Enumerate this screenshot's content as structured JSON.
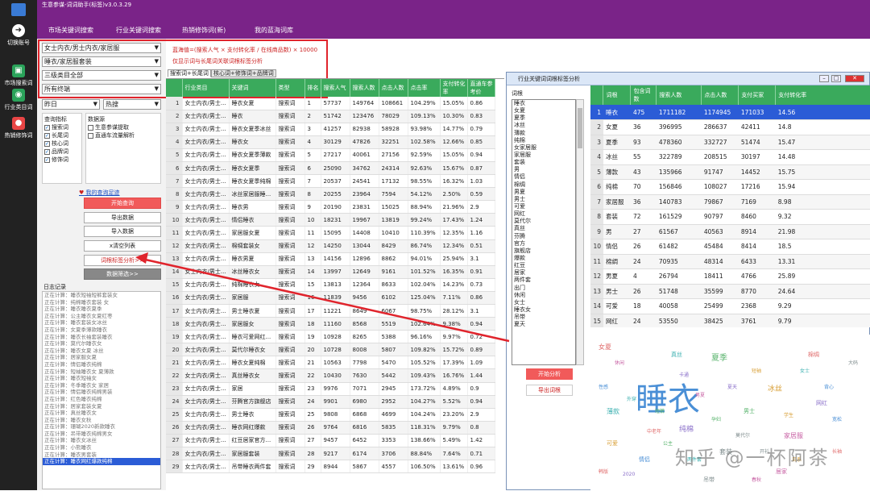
{
  "app": {
    "title": "生意参谋-词词助手(标签)v3.0.3.29"
  },
  "strip": [
    {
      "label": "切换账号",
      "icon": "arrow-right-icon",
      "color": "#ffffff"
    },
    {
      "label": "市场搜索词",
      "icon": "search-bubble-icon",
      "color": "#2aa35a"
    },
    {
      "label": "行业类目词",
      "icon": "chat-bubble-icon",
      "color": "#2aa35a"
    },
    {
      "label": "热销修饰词",
      "icon": "flame-icon",
      "color": "#e84545"
    }
  ],
  "nav": {
    "tabs": [
      "市场关键词搜索",
      "行业关键词搜索",
      "热销修饰词(新)",
      "我的蓝海词库"
    ],
    "active": 1
  },
  "filters": {
    "category": "女士内衣/男士内衣/家居服",
    "subcategory": "睡衣/家居服套装",
    "level3": "三级类目全部",
    "terminal": "所有终端",
    "period": "昨日",
    "sort": "热搜"
  },
  "indicators": {
    "title": "查询指标",
    "items": [
      {
        "label": "搜索词",
        "checked": true
      },
      {
        "label": "长尾词",
        "checked": true
      },
      {
        "label": "核心词",
        "checked": true
      },
      {
        "label": "品牌词",
        "checked": true
      },
      {
        "label": "修饰词",
        "checked": true
      }
    ]
  },
  "datasource": {
    "title": "数据源",
    "items": [
      {
        "label": "生意参谋提取",
        "checked": false
      },
      {
        "label": "直通车流量解析",
        "checked": false
      }
    ]
  },
  "buttons": {
    "link": "我的查询足迹",
    "start": "开始查询",
    "export": "导出数据",
    "import": "导入数据",
    "clear": "x清空列表",
    "tag_analysis": "词根标签分析>>",
    "filter": "数据筛选>>"
  },
  "log": {
    "title": "日志记录",
    "lines": [
      "正在计算：睡衣短袖短裤套装女",
      "正在计算：纯棉睡衣套装 女",
      "正在计算：睡衣睡衣夏季",
      "正在计算：公主睡衣女夏红枣",
      "正在计算：睡衣套装女冰丝",
      "正在计算：女夏季薄款睡衣",
      "正在计算：睡衣长袖套装睡衣",
      "正在计算：莫代尔睡衣女",
      "正在计算：睡衣女夏 冰丝",
      "正在计算：居家服女夏",
      "正在计算：情侣睡衣纯棉",
      "正在计算：短袖睡衣女 夏薄款",
      "正在计算：睡衣短袖女",
      "正在计算：冬季睡衣女 家居",
      "正在计算：情侣睡衣纯棉男装",
      "正在计算：红色睡衣纯棉",
      "正在计算：居家套装女夏",
      "正在计算：真丝睡衣女",
      "正在计算：睡衣女秋",
      "正在计算：珊瑚2020新款睡衣",
      "正在计算：吊带睡衣纯棉男女",
      "正在计算：睡衣女冰丝",
      "正在计算：小熊睡衣",
      "正在计算：睡衣男套装",
      "正在计算：睡衣网红爆款纯棉"
    ]
  },
  "formula": "蓝海值=(搜索人气 × 支付转化率 / 在线商品数) × 10000",
  "subtitle": "仅显示词与长尾词关联词根标签分析",
  "subtabs": [
    "搜索词+长尾词",
    "核心词+修饰词+品牌词"
  ],
  "table": {
    "headers": [
      "",
      "行业类目",
      "关键词",
      "类型",
      "排名",
      "搜索人气",
      "搜索人数",
      "点击人数",
      "点击率",
      "支付转化率",
      "直通车参考价"
    ],
    "rows": [
      [
        "1",
        "女士内衣/男士...",
        "睡衣女夏",
        "搜索词",
        "1",
        "57737",
        "149764",
        "108661",
        "104.29%",
        "15.05%",
        "0.86"
      ],
      [
        "2",
        "女士内衣/男士...",
        "睡衣",
        "搜索词",
        "2",
        "51742",
        "123476",
        "78029",
        "109.13%",
        "10.30%",
        "0.83"
      ],
      [
        "3",
        "女士内衣/男士...",
        "睡衣女夏季冰丝",
        "搜索词",
        "3",
        "41257",
        "82938",
        "58928",
        "93.98%",
        "14.77%",
        "0.79"
      ],
      [
        "4",
        "女士内衣/男士...",
        "睡衣女",
        "搜索词",
        "4",
        "30129",
        "47826",
        "32251",
        "102.58%",
        "12.66%",
        "0.85"
      ],
      [
        "5",
        "女士内衣/男士...",
        "睡衣女夏季薄款",
        "搜索词",
        "5",
        "27217",
        "40061",
        "27156",
        "92.59%",
        "15.05%",
        "0.94"
      ],
      [
        "6",
        "女士内衣/男士...",
        "睡衣女夏季",
        "搜索词",
        "6",
        "25090",
        "34762",
        "24314",
        "92.63%",
        "15.67%",
        "0.87"
      ],
      [
        "7",
        "女士内衣/男士...",
        "睡衣女夏季纯棉",
        "搜索词",
        "7",
        "20537",
        "24541",
        "17132",
        "98.55%",
        "16.32%",
        "1.03"
      ],
      [
        "8",
        "女士内衣/男士...",
        "冰丝家居服睡...",
        "搜索词",
        "8",
        "20255",
        "23964",
        "7594",
        "54.12%",
        "2.50%",
        "0.59"
      ],
      [
        "9",
        "女士内衣/男士...",
        "睡衣男",
        "搜索词",
        "9",
        "20190",
        "23831",
        "15025",
        "88.94%",
        "21.96%",
        "2.9"
      ],
      [
        "10",
        "女士内衣/男士...",
        "情侣睡衣",
        "搜索词",
        "10",
        "18231",
        "19967",
        "13819",
        "99.24%",
        "17.43%",
        "1.24"
      ],
      [
        "11",
        "女士内衣/男士...",
        "家居服女夏",
        "搜索词",
        "11",
        "15095",
        "14408",
        "10410",
        "110.39%",
        "12.35%",
        "1.16"
      ],
      [
        "12",
        "女士内衣/男士...",
        "棉绸套装女",
        "搜索词",
        "12",
        "14250",
        "13044",
        "8429",
        "86.74%",
        "12.34%",
        "0.51"
      ],
      [
        "13",
        "女士内衣/男士...",
        "睡衣男夏",
        "搜索词",
        "13",
        "14156",
        "12896",
        "8862",
        "94.01%",
        "25.94%",
        "3.1"
      ],
      [
        "14",
        "女士内衣/男士...",
        "冰丝睡衣女",
        "搜索词",
        "14",
        "13997",
        "12649",
        "9161",
        "101.52%",
        "16.35%",
        "0.91"
      ],
      [
        "15",
        "女士内衣/男士...",
        "纯棉睡衣女",
        "搜索词",
        "15",
        "13813",
        "12364",
        "8633",
        "102.04%",
        "14.23%",
        "0.73"
      ],
      [
        "16",
        "女士内衣/男士...",
        "家居服",
        "搜索词",
        "16",
        "11839",
        "9456",
        "6102",
        "125.04%",
        "7.11%",
        "0.86"
      ],
      [
        "17",
        "女士内衣/男士...",
        "男士睡衣夏",
        "搜索词",
        "17",
        "11221",
        "8649",
        "6067",
        "98.75%",
        "28.12%",
        "3.1"
      ],
      [
        "18",
        "女士内衣/男士...",
        "家居服女",
        "搜索词",
        "18",
        "11160",
        "8568",
        "5519",
        "102.64%",
        "9.38%",
        "0.94"
      ],
      [
        "19",
        "女士内衣/男士...",
        "睡衣可爱网红...",
        "搜索词",
        "19",
        "10928",
        "8265",
        "5388",
        "96.16%",
        "9.97%",
        "0.72"
      ],
      [
        "20",
        "女士内衣/男士...",
        "莫代尔睡衣女",
        "搜索词",
        "20",
        "10728",
        "8008",
        "5807",
        "109.82%",
        "15.72%",
        "0.89"
      ],
      [
        "21",
        "女士内衣/男士...",
        "睡衣女夏纯棉",
        "搜索词",
        "21",
        "10563",
        "7798",
        "5470",
        "105.52%",
        "17.39%",
        "1.09"
      ],
      [
        "22",
        "女士内衣/男士...",
        "真丝睡衣女",
        "搜索词",
        "22",
        "10430",
        "7630",
        "5442",
        "109.43%",
        "16.76%",
        "1.44"
      ],
      [
        "23",
        "女士内衣/男士...",
        "家居",
        "搜索词",
        "23",
        "9976",
        "7071",
        "2945",
        "173.72%",
        "4.89%",
        "0.9"
      ],
      [
        "24",
        "女士内衣/男士...",
        "芬腾官方旗舰店",
        "搜索词",
        "24",
        "9901",
        "6980",
        "2952",
        "104.27%",
        "5.52%",
        "0.94"
      ],
      [
        "25",
        "女士内衣/男士...",
        "男士睡衣",
        "搜索词",
        "25",
        "9808",
        "6868",
        "4699",
        "104.24%",
        "23.20%",
        "2.9"
      ],
      [
        "26",
        "女士内衣/男士...",
        "睡衣网红爆款",
        "搜索词",
        "26",
        "9764",
        "6816",
        "5835",
        "118.31%",
        "9.79%",
        "0.8"
      ],
      [
        "27",
        "女士内衣/男士...",
        "红豆居家官方...",
        "搜索词",
        "27",
        "9457",
        "6452",
        "3353",
        "138.66%",
        "5.49%",
        "1.42"
      ],
      [
        "28",
        "女士内衣/男士...",
        "家居服套装",
        "搜索词",
        "28",
        "9217",
        "6174",
        "3706",
        "88.84%",
        "7.64%",
        "0.71"
      ],
      [
        "29",
        "女士内衣/男士...",
        "吊带睡衣两件套",
        "搜索词",
        "29",
        "8944",
        "5867",
        "4557",
        "106.50%",
        "13.61%",
        "0.96"
      ]
    ]
  },
  "dialog": {
    "title": "行业关键词词根标签分析",
    "label": "词根",
    "words": [
      "睡衣",
      "女夏",
      "夏季",
      "冰丝",
      "薄款",
      "纯棉",
      "女家居服",
      "家居服",
      "套装",
      "男",
      "情侣",
      "棉绸",
      "男夏",
      "男士",
      "可爱",
      "网红",
      "莫代尔",
      "真丝",
      "芬腾",
      "官方",
      "旗舰店",
      "爆款",
      "红豆",
      "居家",
      "两件套",
      "出门",
      "休闲",
      "女士",
      "睡衣女",
      "吊带",
      "夏天"
    ],
    "btn_analyze": "开始分析",
    "btn_export": "导出词根",
    "headers": [
      "",
      "词根",
      "包含词数",
      "搜索人数",
      "点击人数",
      "支付买家",
      "支付转化率"
    ],
    "rows": [
      [
        "1",
        "睡衣",
        "475",
        "1711182",
        "1174945",
        "171033",
        "14.56"
      ],
      [
        "2",
        "女夏",
        "36",
        "396995",
        "286637",
        "42411",
        "14.8"
      ],
      [
        "3",
        "夏季",
        "93",
        "478360",
        "332727",
        "51474",
        "15.47"
      ],
      [
        "4",
        "冰丝",
        "55",
        "322789",
        "208515",
        "30197",
        "14.48"
      ],
      [
        "5",
        "薄款",
        "43",
        "135966",
        "91747",
        "14452",
        "15.75"
      ],
      [
        "6",
        "纯棉",
        "70",
        "156846",
        "108027",
        "17216",
        "15.94"
      ],
      [
        "7",
        "家居服",
        "36",
        "140783",
        "79867",
        "7169",
        "8.98"
      ],
      [
        "8",
        "套装",
        "72",
        "161529",
        "90797",
        "8460",
        "9.32"
      ],
      [
        "9",
        "男",
        "27",
        "61567",
        "40563",
        "8914",
        "21.98"
      ],
      [
        "10",
        "情侣",
        "26",
        "61482",
        "45484",
        "8414",
        "18.5"
      ],
      [
        "11",
        "棉绸",
        "24",
        "70935",
        "48314",
        "6433",
        "13.31"
      ],
      [
        "12",
        "男夏",
        "4",
        "26794",
        "18411",
        "4766",
        "25.89"
      ],
      [
        "13",
        "男士",
        "26",
        "51748",
        "35599",
        "8770",
        "24.64"
      ],
      [
        "14",
        "可爱",
        "18",
        "40058",
        "25499",
        "2368",
        "9.29"
      ],
      [
        "15",
        "网红",
        "24",
        "53550",
        "38425",
        "3761",
        "9.79"
      ]
    ],
    "cloud_words": [
      "睡衣",
      "女夏",
      "夏季",
      "冰丝",
      "纯棉",
      "薄款",
      "家居服",
      "套装",
      "情侣",
      "棉绸",
      "男士",
      "可爱",
      "网红",
      "真丝",
      "居家",
      "吊带",
      "性感",
      "长袖",
      "短裤",
      "短袖",
      "2020",
      "女士",
      "男夏",
      "莫代尔",
      "宽松",
      "韩版",
      "公主",
      "学生",
      "夏天",
      "两件套",
      "休闲",
      "开衫",
      "背心",
      "中老年",
      "孕妇",
      "日系",
      "卡通",
      "外穿",
      "春秋",
      "大码"
    ]
  },
  "watermark": "知乎 @一杯阿茶"
}
